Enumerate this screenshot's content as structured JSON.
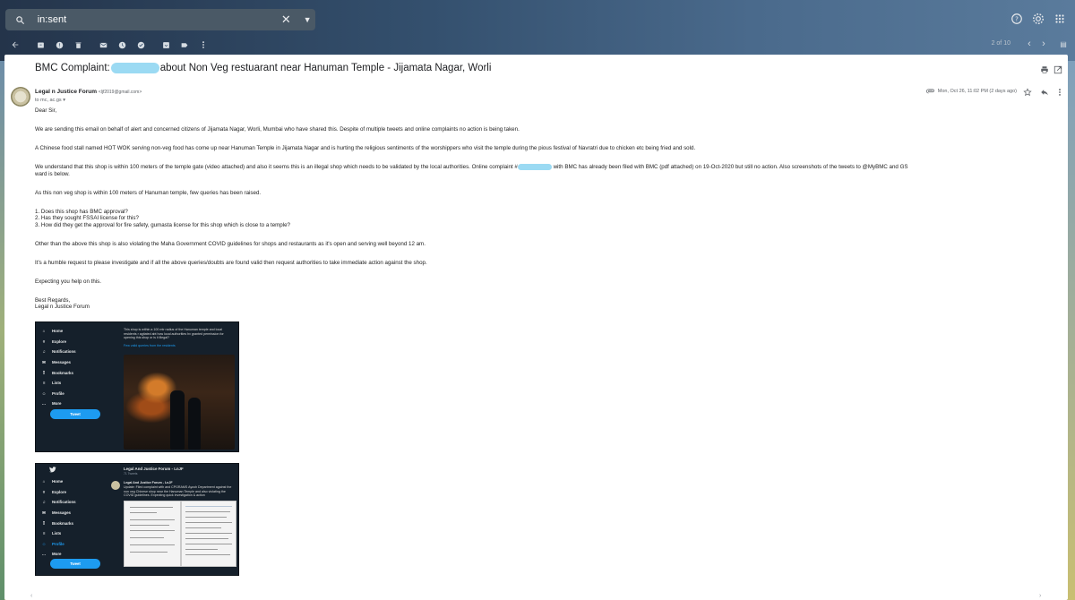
{
  "search": {
    "value": "in:sent"
  },
  "pager": {
    "text": "2 of 10"
  },
  "email": {
    "subject_part1": "BMC Complaint:",
    "subject_part2": "about Non Veg restuarant near Hanuman Temple - Jijamata Nagar, Worli",
    "sender_name": "Legal n Justice Forum",
    "sender_email": "<ljf2019@gmail.com>",
    "to": "to mc, ac.gs",
    "date": "Mon, Oct 26, 11:02 PM (2 days ago)",
    "body": {
      "greeting": "Dear Sir,",
      "p1": "We are sending this email on behalf of alert and concerned citizens of Jijamata Nagar, Worli, Mumbai who have shared this. Despite of multiple tweets and online complaints no action is being taken.",
      "p2": "A Chinese food stall named HOT WOK serving non-veg food has come up near Hanuman Temple in Jijamata Nagar and is hurting the religious sentiments of the worshippers who visit the temple during the pious festival of Navratri due to chicken etc being fried and sold.",
      "p3a": "We understand that this shop is within 100 meters of the temple gate (video attached) and also it seems this is an illegal shop which needs to be validated by the local authorities.  Online complaint #",
      "p3b": "with BMC has already been filed with BMC (pdf attached) on 19-Oct-2020 but still no action. Also screenshots of the tweets to @MyBMC and GS",
      "p3c": "ward is below.",
      "p4": "As this non veg shop is within 100 meters of Hanuman temple, few queries has been raised.",
      "q1": "1. Does this shop has BMC approval?",
      "q2": "2. Has they sought FSSAI license for this?",
      "q3": "3. How did they get the approval for fire safety, gumasta license for this shop which is close to a temple?",
      "p5": "Other than the above this shop is also violating the Maha Government COVID guidelines for shops and restaurants as it's open and serving well beyond 12 am.",
      "p6": "It's a humble request to please investigate and if all the above queries/doubts are found valid then request authorities to take immediate action against the shop.",
      "p7": "Expecting you help on this.",
      "closing": "Best Regards,",
      "signature": "Legal n Justice Forum"
    }
  },
  "twitter_nav": [
    "Home",
    "Explore",
    "Notifications",
    "Messages",
    "Bookmarks",
    "Lists",
    "Profile",
    "More"
  ],
  "tweet_button": "Tweet",
  "shot1": {
    "text": "This shop is within a 100 mtr radius of the Hanuman temple and local residents r agitated abt how local authorities hv granted permission for opening this shop or is it illegal?",
    "queries": "Few valid queries from the residents"
  },
  "shot2": {
    "profile_name": "Legal And Justice Forum - LnJF",
    "profile_sub": "71 Tweets",
    "tweet_author": "Legal And Justice Forum - LnJF",
    "tweet_text": "Update: Filed complaint with and CPGRAMS Ayush Department against the non veg Chinese shop near the Hanuman Temple and also violating the COVID guidelines. Expecting quick investigation & action"
  },
  "colors": {
    "accent": "#1d9bf0",
    "redaction": "#8ad3f1",
    "twitter_bg": "#15202b"
  }
}
